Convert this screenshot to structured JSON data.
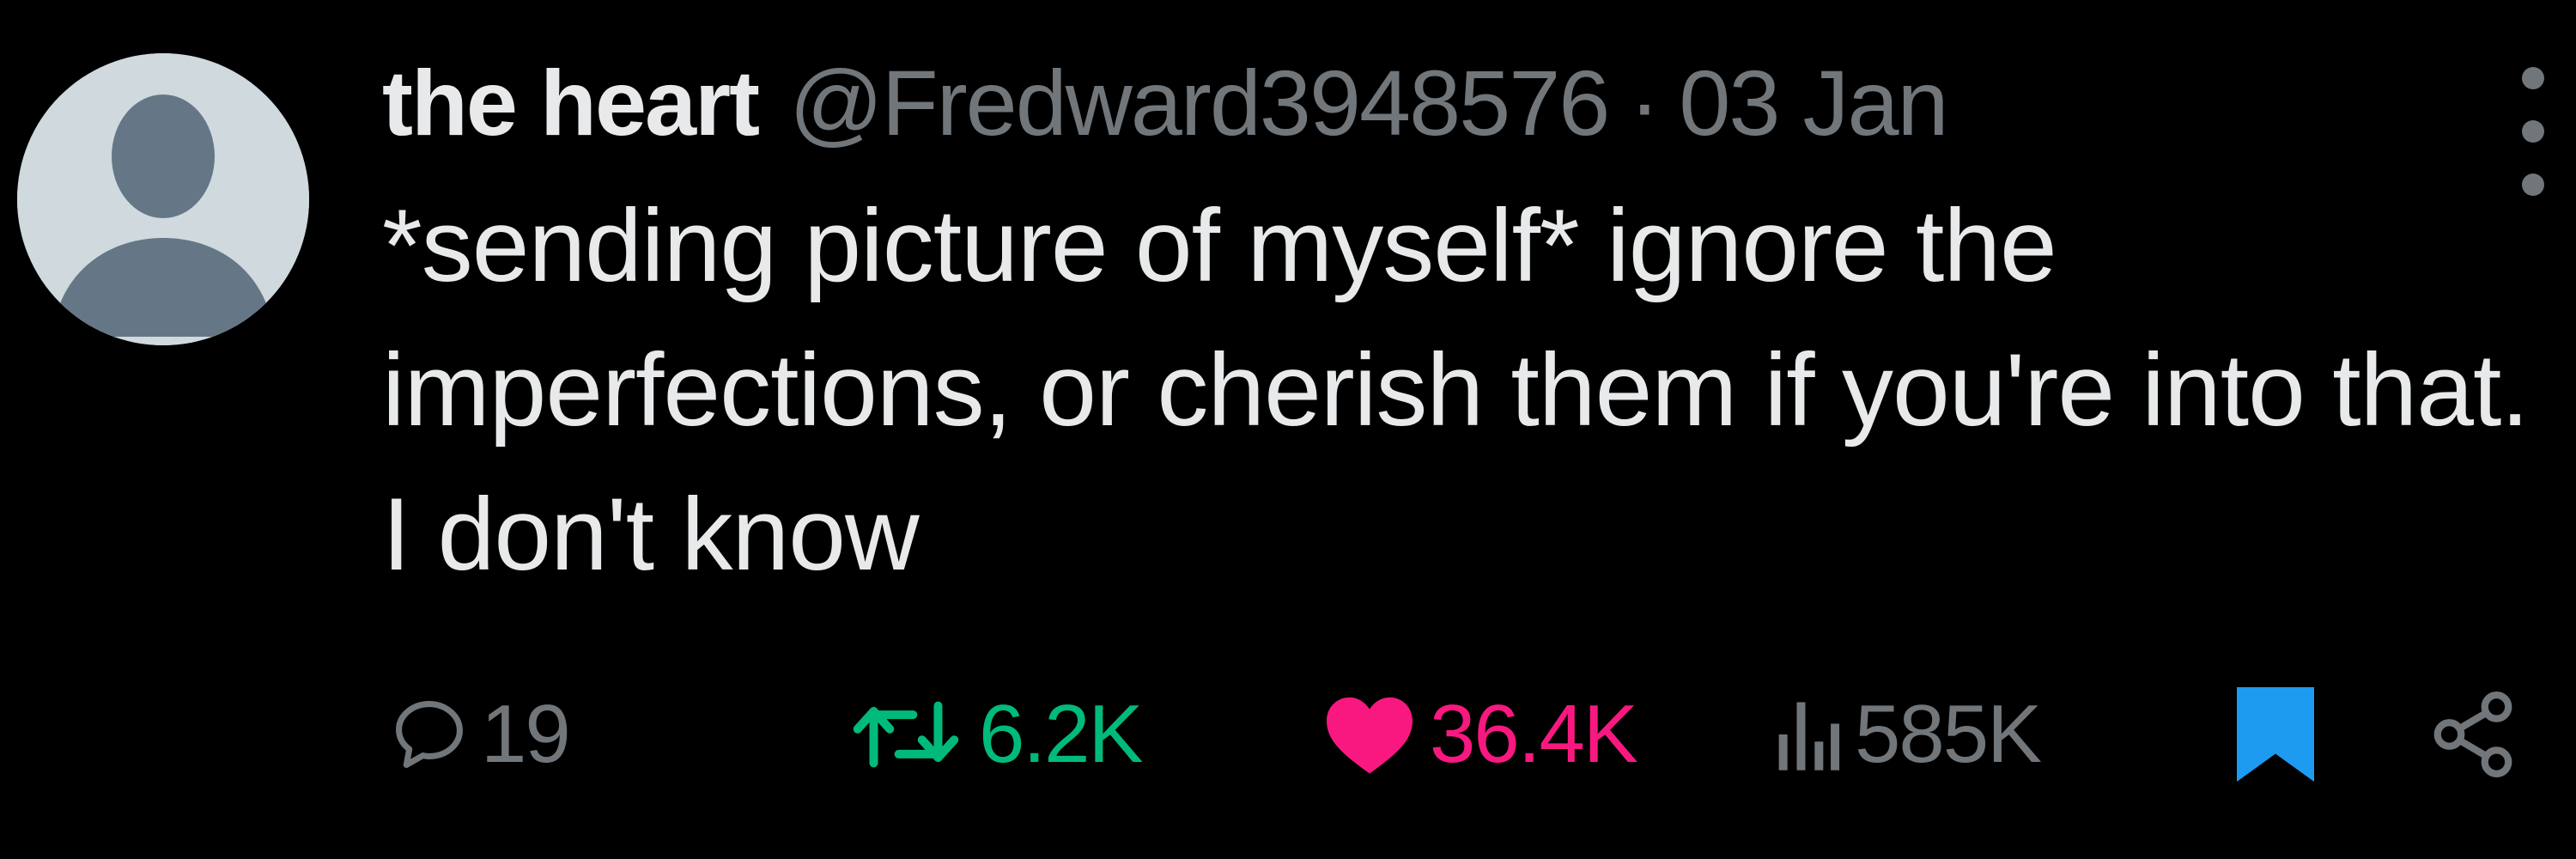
{
  "tweet": {
    "author_name": "the heart",
    "handle": "@Fredward3948576",
    "separator": "·",
    "date": "03 Jan",
    "text": "*sending picture of myself* ignore the imperfections, or cherish them if you're into that. I don't know"
  },
  "actions": {
    "replies": "19",
    "retweets": "6.2K",
    "likes": "36.4K",
    "views": "585K",
    "liked": true,
    "retweeted": true,
    "bookmarked": true
  },
  "icons": {
    "more": "more-vertical-icon",
    "reply": "reply-icon",
    "retweet": "retweet-icon",
    "like": "heart-icon",
    "views": "views-icon",
    "bookmark": "bookmark-icon",
    "share": "share-icon"
  },
  "colors": {
    "background": "#000000",
    "text_primary": "#e7e9ea",
    "text_secondary": "#71767b",
    "retweet": "#00ba7c",
    "like": "#f91880",
    "bookmark": "#1d9bf0",
    "avatar_bg": "#cfd9de",
    "avatar_fg": "#657786"
  }
}
